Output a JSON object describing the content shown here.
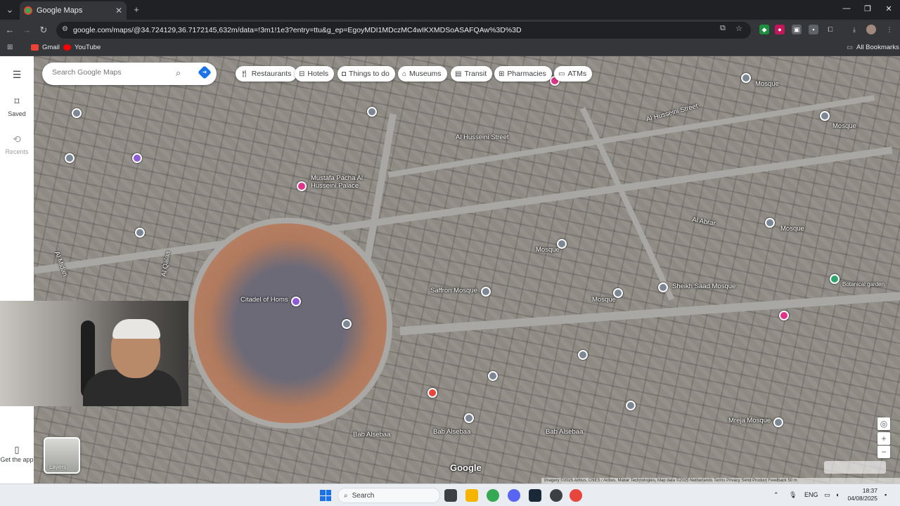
{
  "browser": {
    "tab_title": "Google Maps",
    "new_tab": "+",
    "url": "google.com/maps/@34.724129,36.7172145,632m/data=!3m1!1e3?entry=ttu&g_ep=EgoyMDI1MDczMC4wIKXMDSoASAFQAw%3D%3D",
    "bookmarks": [
      {
        "label": "Gmail"
      },
      {
        "label": "YouTube"
      }
    ],
    "all_bookmarks": "All Bookmarks"
  },
  "rail": {
    "saved": "Saved",
    "recents": "Recents",
    "get_app": "Get the app"
  },
  "search": {
    "placeholder": "Search Google Maps"
  },
  "chips": [
    {
      "label": "Restaurants",
      "icon": "fork-knife-icon"
    },
    {
      "label": "Hotels",
      "icon": "bed-icon"
    },
    {
      "label": "Things to do",
      "icon": "camera-icon"
    },
    {
      "label": "Museums",
      "icon": "museum-icon"
    },
    {
      "label": "Transit",
      "icon": "train-icon"
    },
    {
      "label": "Pharmacies",
      "icon": "pharmacy-icon"
    },
    {
      "label": "ATMs",
      "icon": "atm-icon"
    }
  ],
  "map": {
    "labels": {
      "al_husseini_street": "Al Husseini Street",
      "al_husseini_street_2": "Al Husseini Street",
      "mustafa_pasha": "Mustafa Pacha Al Husseini Palace",
      "al_abrar": "Al Abrar",
      "al_qalaa": "Al Qalaa",
      "al_midan": "Al Midan",
      "citadel": "Citadel of Homs",
      "saffron_mosque": "Saffron Mosque",
      "sheikh_saad": "Sheikh Saad Mosque",
      "bab_alsebaa_1": "Bab Alsebaa",
      "bab_alsebaa_2": "Bab Alsebaa",
      "bab_alsebaa_3": "Bab Alsebaa",
      "mreja_mosque": "Mreja Mosque",
      "mosque_1": "Mosque",
      "mosque_2": "Mosque",
      "mosque_3": "Mosque",
      "mosque_4": "Mosque",
      "mosque_5": "Mosque",
      "botanical": "Botanical garden"
    },
    "layers": "Layers",
    "logo": "Google",
    "attribution": "Imagery ©2025 Airbus, CNES / Airbus, Maxar Technologies, Map data ©2025   Netherlands   Terms   Privacy   Send Product Feedback   50 m"
  },
  "taskbar": {
    "search": "Search",
    "lang": "ENG",
    "time": "18:37",
    "date": "04/08/2025"
  }
}
